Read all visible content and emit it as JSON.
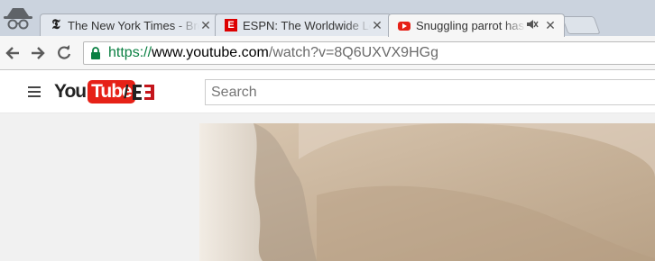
{
  "tabs": [
    {
      "title": "The New York Times - Breaking News",
      "favicon": "nyt-icon"
    },
    {
      "title": "ESPN: The Worldwide Leader in Sports",
      "favicon": "espn-icon"
    },
    {
      "title": "Snuggling parrot has a",
      "favicon": "youtube-icon",
      "muted": true
    }
  ],
  "address": {
    "scheme": "https://",
    "host": "www.youtube.com",
    "path": "/watch?v=8Q6UXVX9HGg"
  },
  "youtube": {
    "logo_you": "You",
    "logo_tube": "Tube",
    "partner_logo": "E3",
    "search_placeholder": "Search"
  },
  "colors": {
    "youtube_red": "#e62117",
    "secure_green": "#0b8043",
    "tabbar": "#cbd3de"
  }
}
